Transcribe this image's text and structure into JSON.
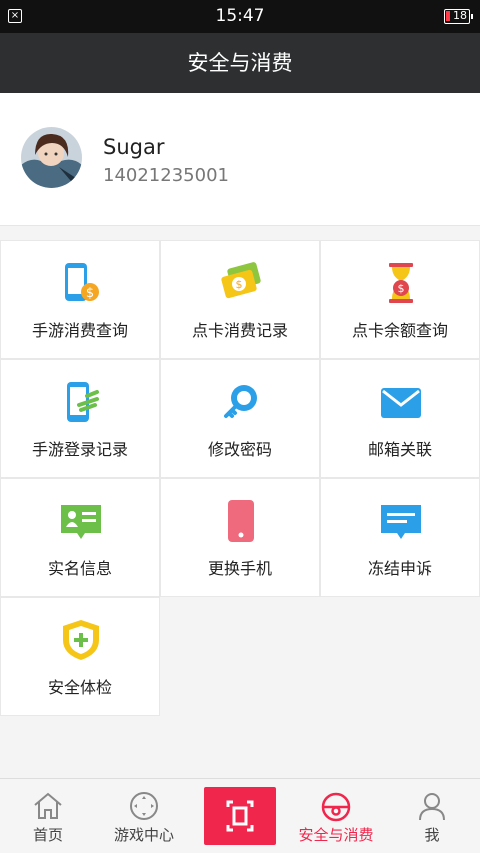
{
  "status_bar": {
    "time": "15:47",
    "battery": "18"
  },
  "header": {
    "title": "安全与消费"
  },
  "profile": {
    "name": "Sugar",
    "phone": "14021235001"
  },
  "grid": [
    {
      "label": "手游消费查询",
      "icon": "phone-coin-icon"
    },
    {
      "label": "点卡消费记录",
      "icon": "money-card-icon"
    },
    {
      "label": "点卡余额查询",
      "icon": "hourglass-coin-icon"
    },
    {
      "label": "手游登录记录",
      "icon": "phone-login-icon"
    },
    {
      "label": "修改密码",
      "icon": "key-icon"
    },
    {
      "label": "邮箱关联",
      "icon": "mail-icon"
    },
    {
      "label": "实名信息",
      "icon": "id-card-icon"
    },
    {
      "label": "更换手机",
      "icon": "phone-icon"
    },
    {
      "label": "冻结申诉",
      "icon": "message-icon"
    },
    {
      "label": "安全体检",
      "icon": "shield-plus-icon"
    }
  ],
  "tabbar": [
    {
      "label": "首页",
      "icon": "home-icon"
    },
    {
      "label": "游戏中心",
      "icon": "gamepad-icon"
    },
    {
      "label": "",
      "icon": "scan-icon"
    },
    {
      "label": "安全与消费",
      "icon": "safety-icon",
      "active": true
    },
    {
      "label": "我",
      "icon": "user-icon"
    }
  ],
  "colors": {
    "accent": "#f0264c",
    "header_bg": "#2d2f31"
  }
}
